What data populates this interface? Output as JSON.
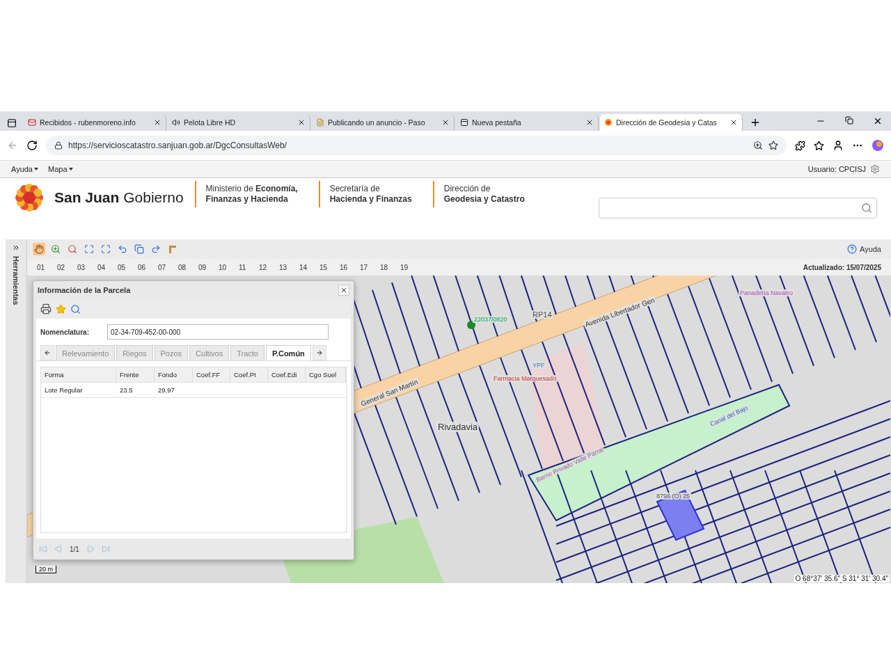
{
  "browser": {
    "tabs": [
      {
        "title": "Recibidos - rubenmoreno.info",
        "kind": "mail",
        "selected": false
      },
      {
        "title": "Pelota Libre HD",
        "kind": "sound",
        "selected": false
      },
      {
        "title": "Publicando un anuncio - Paso",
        "kind": "page",
        "selected": false
      },
      {
        "title": "Nueva pestaña",
        "kind": "newtab",
        "selected": false
      },
      {
        "title": "Dirección de Geodesia y Catas",
        "kind": "logo",
        "selected": true
      }
    ],
    "url": "https://servicioscatastro.sanjuan.gob.ar/DgcConsultasWeb/"
  },
  "app_menu": {
    "items": [
      "Ayuda",
      "Mapa"
    ],
    "user": "Usuario: CPCISJ"
  },
  "header": {
    "brand_bold": "San Juan",
    "brand_light": "Gobierno",
    "blocks": [
      {
        "line1": "Ministerio de **Economía,**",
        "line2": "Finanzas y Hacienda"
      },
      {
        "line1": "Secretaría de",
        "line2": "Hacienda y Finanzas"
      },
      {
        "line1": "Dirección de",
        "line2": "Geodesia y Catastro"
      }
    ]
  },
  "side_panel": {
    "title": "Herramientas"
  },
  "toolbar": {
    "help": "Ayuda",
    "numbers": [
      "01",
      "02",
      "03",
      "04",
      "05",
      "06",
      "07",
      "08",
      "09",
      "10",
      "11",
      "12",
      "13",
      "14",
      "15",
      "16",
      "17",
      "18",
      "19"
    ],
    "updated": "Actualizado: 15/07/2025"
  },
  "map": {
    "labels": [
      "Avenida Libertador Gen",
      "RP14",
      "General San Martín",
      "Rivadavia",
      "Canal del Bajo",
      "Barrio Privado Valle Parral",
      "Panadería Navarro",
      "Farmacia Marquesado",
      "YPF",
      "22037/0820",
      "8796 (O) 25"
    ],
    "scale": "20 m",
    "coordinates": "O 68°37' 35.6\" S 31° 31' 30.4\""
  },
  "dialog": {
    "title": "Información de la Parcela",
    "field_label": "Nomenclatura:",
    "field_value": "02-34-709-452-00-000",
    "tabs": [
      {
        "label": "Relevamiento",
        "selected": false
      },
      {
        "label": "Riegos",
        "selected": false
      },
      {
        "label": "Pozos",
        "selected": false
      },
      {
        "label": "Cultivos",
        "selected": false
      },
      {
        "label": "Tracto",
        "selected": false
      },
      {
        "label": "P.Común",
        "selected": true
      }
    ],
    "columns": [
      "Forma",
      "Frente",
      "Fondo",
      "Coef.FF",
      "Coef.PI",
      "Coef.Edi",
      "Cgo Suel"
    ],
    "rows": [
      [
        "Lote Regular",
        "23.5",
        "29.97",
        "",
        "",
        "",
        ""
      ]
    ],
    "pager": "1/1"
  }
}
